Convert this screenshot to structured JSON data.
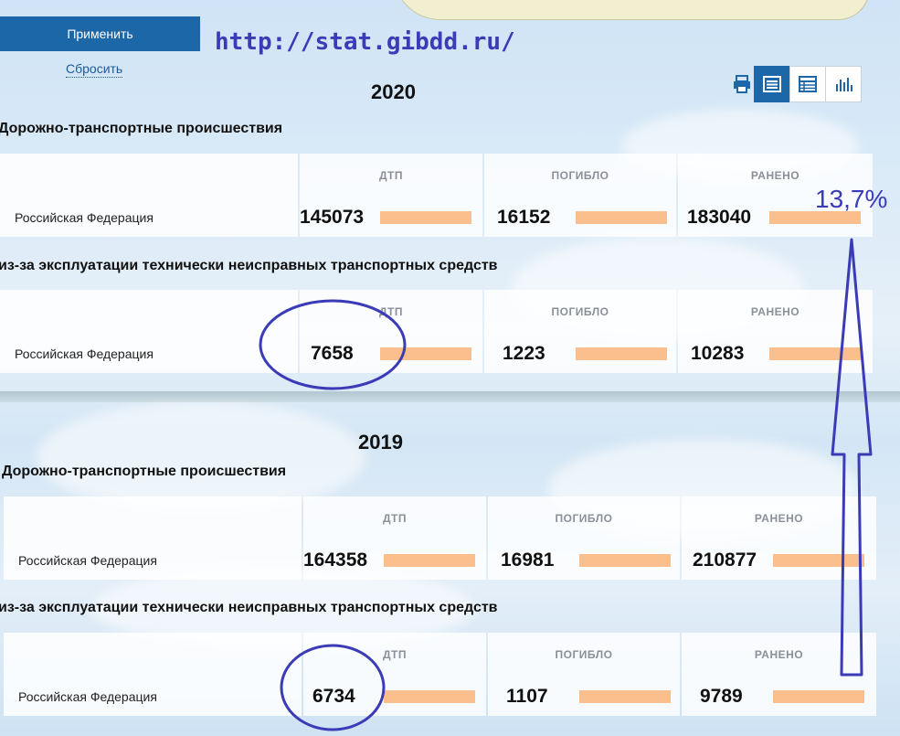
{
  "controls": {
    "apply_label": "Применить",
    "reset_label": "Сбросить"
  },
  "watermark_url": "http://stat.gibdd.ru/",
  "view_icons": [
    "print-icon",
    "list-view-icon",
    "table-view-icon",
    "chart-view-icon"
  ],
  "columns": {
    "dtp": "ДТП",
    "killed": "ПОГИБЛО",
    "injured": "РАНЕНО"
  },
  "region": "Российская Федерация",
  "y2020": {
    "year": "2020",
    "all": {
      "title": "Дорожно-транспортные происшествия",
      "dtp": "145073",
      "killed": "16152",
      "injured": "183040"
    },
    "faulty": {
      "title": "из-за эксплуатации технически неисправных транспортных средств",
      "dtp": "7658",
      "killed": "1223",
      "injured": "10283"
    }
  },
  "y2019": {
    "year": "2019",
    "all": {
      "title": "Дорожно-транспортные происшествия",
      "dtp": "164358",
      "killed": "16981",
      "injured": "210877"
    },
    "faulty": {
      "title": "из-за эксплуатации технически неисправных транспортных средств",
      "dtp": "6734",
      "killed": "1107",
      "injured": "9789"
    }
  },
  "annotation": {
    "percent": "13,7%",
    "color": "#3b3bb8"
  },
  "colors": {
    "accent": "#1c67a8",
    "bar": "#fbbf8d"
  }
}
